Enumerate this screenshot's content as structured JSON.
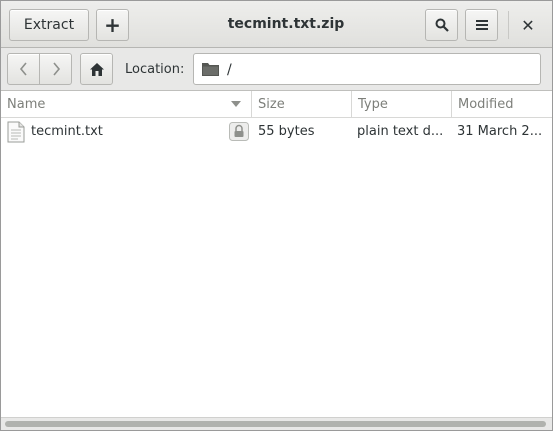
{
  "window": {
    "title": "tecmint.txt.zip"
  },
  "header": {
    "extract_label": "Extract",
    "add_label": "+",
    "close_label": "✕"
  },
  "icons": {
    "add": "plus-icon",
    "search": "search-icon",
    "menu": "hamburger-menu-icon",
    "close": "close-icon",
    "back": "chevron-left-icon",
    "forward": "chevron-right-icon",
    "home": "home-icon",
    "folder": "folder-icon",
    "file": "text-file-icon",
    "lock": "lock-icon",
    "sort": "sort-descending-icon"
  },
  "toolbar": {
    "location_label": "Location:",
    "location_value": "/"
  },
  "columns": [
    "Name",
    "Size",
    "Type",
    "Modified"
  ],
  "files": [
    {
      "name": "tecmint.txt",
      "size": "55 bytes",
      "type": "plain text d...",
      "modified": "31 March 2..."
    }
  ],
  "colors": {
    "accent": "#b6b6b3",
    "header_text": "#7d7f7a"
  }
}
